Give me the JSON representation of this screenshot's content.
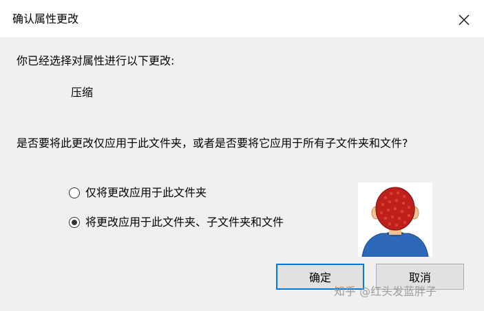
{
  "dialog": {
    "title": "确认属性更改",
    "intro": "你已经选择对属性进行以下更改:",
    "change": "压缩",
    "question": "是否要将此更改仅应用于此文件夹，或者是否要将它应用于所有子文件夹和文件?",
    "options": [
      {
        "label": "仅将更改应用于此文件夹",
        "checked": false
      },
      {
        "label": "将更改应用于此文件夹、子文件夹和文件",
        "checked": true
      }
    ],
    "buttons": {
      "ok": "确定",
      "cancel": "取消"
    }
  },
  "watermark": "知乎 @红头发蓝胖子",
  "icons": {
    "close": "close-icon",
    "avatar": "red-haired-person-avatar"
  },
  "colors": {
    "accent": "#0078d7",
    "hair": "#c0201c",
    "shirt": "#2e68b8"
  }
}
